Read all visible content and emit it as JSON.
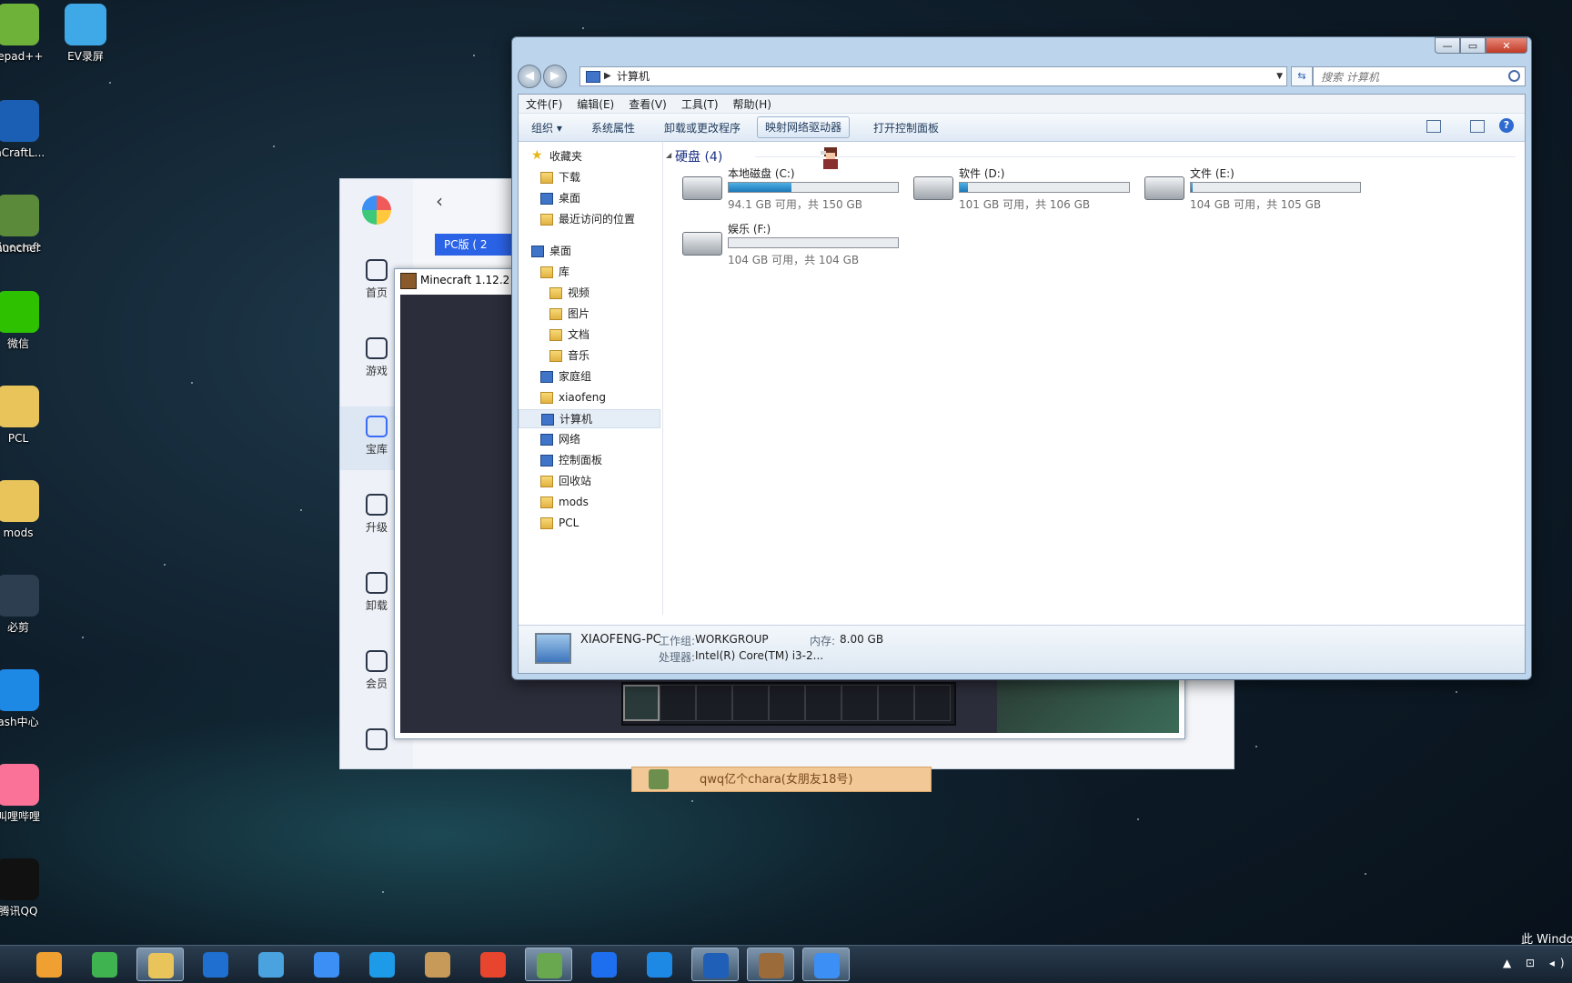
{
  "desktop": {
    "icons": [
      {
        "label": "tepad++",
        "color": "#6fb23a"
      },
      {
        "label": "EV录屏",
        "color": "#3fa9e8"
      },
      {
        "label": "inCraftL...",
        "color": "#1a5fb4"
      },
      {
        "label": "linecraft",
        "color": "#5a8a3a"
      },
      {
        "label": "auncher",
        "color": "#5a8a3a"
      },
      {
        "label": "微信",
        "color": "#2dc100"
      },
      {
        "label": "PCL",
        "color": "#e8c45a"
      },
      {
        "label": "mods",
        "color": "#e8c45a"
      },
      {
        "label": "必剪",
        "color": "#2c3e50"
      },
      {
        "label": "ash中心",
        "color": "#1e88e5"
      },
      {
        "label": "叫哩哔哩",
        "color": "#fb7299"
      },
      {
        "label": "腾讯QQ",
        "color": "#111111"
      }
    ],
    "pcl_badge": "PCL",
    "watermark": "此 Windo"
  },
  "app": {
    "nav": [
      {
        "label": "首页"
      },
      {
        "label": "游戏"
      },
      {
        "label": "宝库"
      },
      {
        "label": "升级"
      },
      {
        "label": "卸载"
      },
      {
        "label": "会员"
      }
    ],
    "back": "‹",
    "pc_button": "PC版 ( 2"
  },
  "minecraft": {
    "title": "Minecraft 1.12.2"
  },
  "chat_popup": {
    "text": "qwq亿个chara(女朋友18号)"
  },
  "explorer": {
    "caption": {
      "minimize": "—",
      "maximize": "▭",
      "close": "✕"
    },
    "address": {
      "path": "计算机"
    },
    "search": {
      "placeholder": "搜索 计算机"
    },
    "menu": [
      "文件(F)",
      "编辑(E)",
      "查看(V)",
      "工具(T)",
      "帮助(H)"
    ],
    "toolbar": [
      "组织 ▾",
      "系统属性",
      "卸载或更改程序",
      "映射网络驱动器",
      "打开控制面板"
    ],
    "help": "?",
    "nav_pane": [
      {
        "label": "收藏夹",
        "kind": "star",
        "indent": 0
      },
      {
        "label": "下载",
        "kind": "folder",
        "indent": 1
      },
      {
        "label": "桌面",
        "kind": "monitor",
        "indent": 1
      },
      {
        "label": "最近访问的位置",
        "kind": "folder",
        "indent": 1
      },
      {
        "label": "桌面",
        "kind": "monitor",
        "indent": 0
      },
      {
        "label": "库",
        "kind": "folder",
        "indent": 1
      },
      {
        "label": "视频",
        "kind": "folder",
        "indent": 2
      },
      {
        "label": "图片",
        "kind": "folder",
        "indent": 2
      },
      {
        "label": "文档",
        "kind": "folder",
        "indent": 2
      },
      {
        "label": "音乐",
        "kind": "folder",
        "indent": 2
      },
      {
        "label": "家庭组",
        "kind": "monitor",
        "indent": 1
      },
      {
        "label": "xiaofeng",
        "kind": "folder",
        "indent": 1
      },
      {
        "label": "计算机",
        "kind": "monitor",
        "indent": 1,
        "selected": true
      },
      {
        "label": "网络",
        "kind": "monitor",
        "indent": 1
      },
      {
        "label": "控制面板",
        "kind": "monitor",
        "indent": 1
      },
      {
        "label": "回收站",
        "kind": "folder",
        "indent": 1
      },
      {
        "label": "mods",
        "kind": "folder",
        "indent": 1
      },
      {
        "label": "PCL",
        "kind": "folder",
        "indent": 1
      }
    ],
    "group_title": "硬盘 (4)",
    "drives": [
      {
        "name": "本地磁盘 (C:)",
        "free": "94.1 GB 可用，共 150 GB",
        "used_fraction": 0.373
      },
      {
        "name": "软件 (D:)",
        "free": "101 GB 可用，共 106 GB",
        "used_fraction": 0.047
      },
      {
        "name": "文件 (E:)",
        "free": "104 GB 可用，共 105 GB",
        "used_fraction": 0.01
      },
      {
        "name": "娱乐 (F:)",
        "free": "104 GB 可用，共 104 GB",
        "used_fraction": 0.0
      }
    ],
    "details": {
      "computer_name": "XIAOFENG-PC",
      "workgroup_label": "工作组:",
      "workgroup": "WORKGROUP",
      "memory_label": "内存:",
      "memory": "8.00 GB",
      "cpu_label": "处理器:",
      "cpu": "Intel(R) Core(TM) i3-2..."
    }
  },
  "taskbar": {
    "buttons": [
      {
        "name": "media-player",
        "color": "#f0a030",
        "active": false
      },
      {
        "name": "update-app",
        "color": "#3fb34f",
        "active": false
      },
      {
        "name": "file-explorer",
        "color": "#e8c45a",
        "active": true
      },
      {
        "name": "pcl-launcher-p",
        "color": "#1f6fd1",
        "active": false
      },
      {
        "name": "notes",
        "color": "#4aa3df",
        "active": false
      },
      {
        "name": "baidu-netdisk",
        "color": "#3b8ff5",
        "active": false
      },
      {
        "name": "translator",
        "color": "#1e9be8",
        "active": false
      },
      {
        "name": "paint",
        "color": "#c79a5a",
        "active": false
      },
      {
        "name": "wps",
        "color": "#e8452f",
        "active": false
      },
      {
        "name": "minecraft",
        "color": "#6aa84f",
        "active": true
      },
      {
        "name": "security",
        "color": "#1e6ff0",
        "active": false
      },
      {
        "name": "flash",
        "color": "#1e88e5",
        "active": false
      },
      {
        "name": "pcl-p",
        "color": "#1f5fb8",
        "active": true
      },
      {
        "name": "crafting-table",
        "color": "#9b6b3a",
        "active": true
      },
      {
        "name": "game-center",
        "color": "#3b8ff5",
        "active": true
      }
    ],
    "tray": "▲ ⊡ ◂)"
  }
}
